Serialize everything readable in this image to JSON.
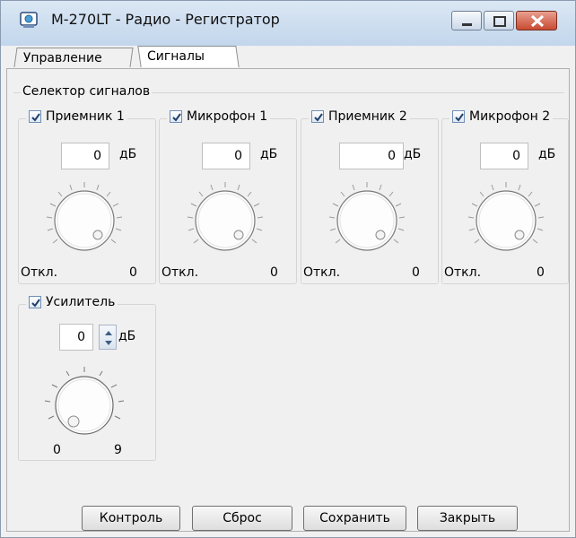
{
  "window": {
    "title": "M-270LT - Радио - Регистратор"
  },
  "tabs": [
    {
      "label": "Управление"
    },
    {
      "label": "Сигналы"
    }
  ],
  "selector": {
    "title": "Селектор сигналов"
  },
  "channels": [
    {
      "name": "Приемник 1",
      "checked": true,
      "db_value": "0",
      "db_unit": "дБ",
      "off_label": "Откл.",
      "max_label": "0"
    },
    {
      "name": "Микрофон 1",
      "checked": true,
      "db_value": "0",
      "db_unit": "дБ",
      "off_label": "Откл.",
      "max_label": "0"
    },
    {
      "name": "Приемник 2",
      "checked": true,
      "db_value": "0",
      "db_unit": "дБ",
      "off_label": "Откл.",
      "max_label": "0"
    },
    {
      "name": "Микрофон 2",
      "checked": true,
      "db_value": "0",
      "db_unit": "дБ",
      "off_label": "Откл.",
      "max_label": "0"
    }
  ],
  "amplifier": {
    "name": "Усилитель",
    "checked": true,
    "db_value": "0",
    "db_unit": "дБ",
    "min_label": "0",
    "max_label": "9"
  },
  "buttons": {
    "control": "Контроль",
    "reset": "Сброс",
    "save": "Сохранить",
    "close": "Закрыть"
  },
  "colors": {
    "titlebar": "#c9dbef",
    "close_button": "#c94a32",
    "face": "#f0f0f0"
  }
}
